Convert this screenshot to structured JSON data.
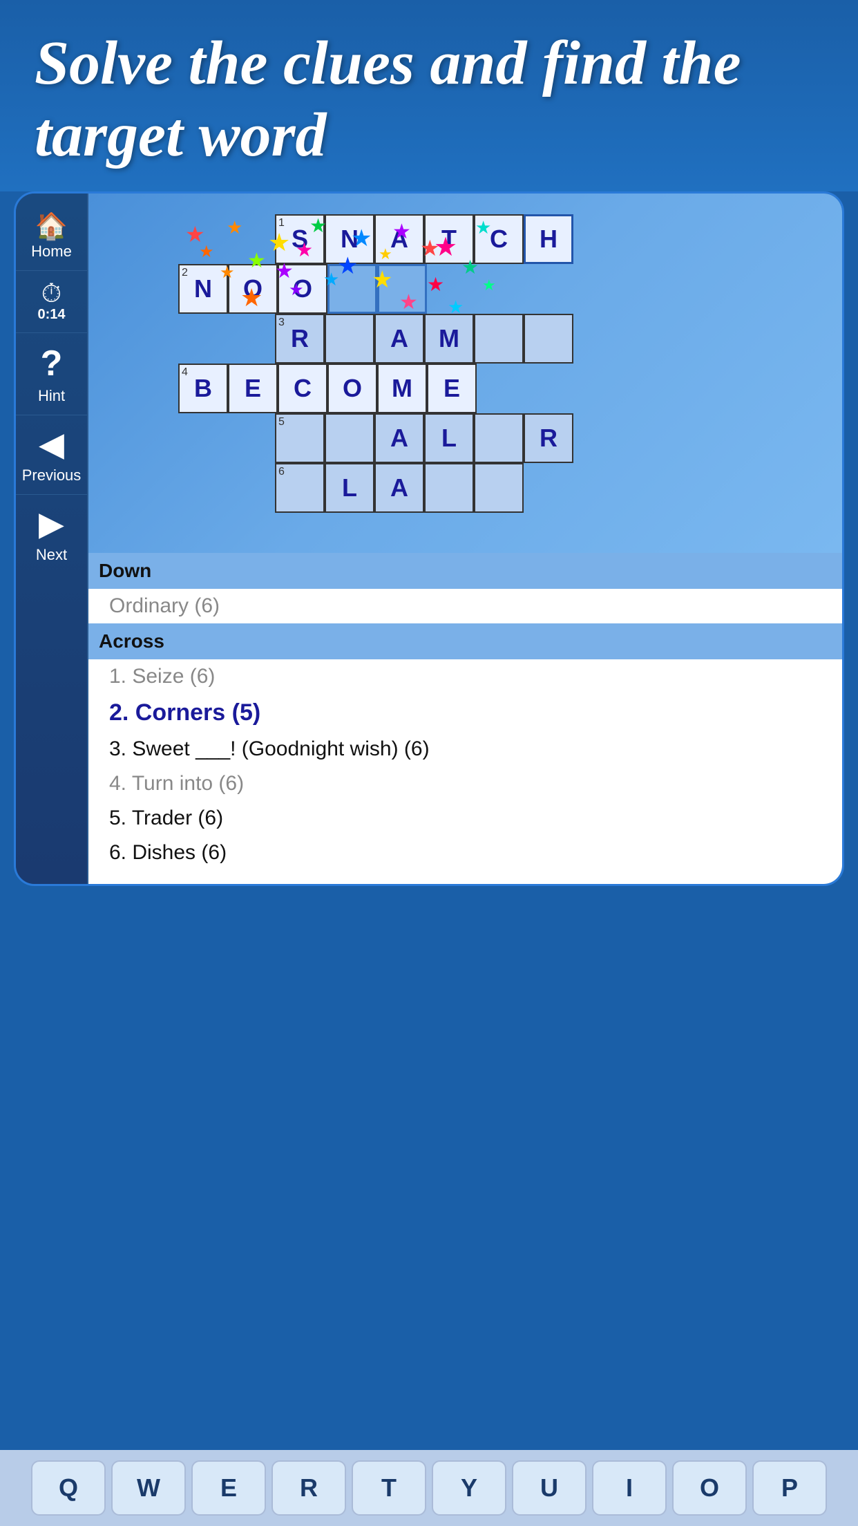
{
  "header": {
    "title": "Solve the clues and find the target word"
  },
  "sidebar": {
    "home_label": "Home",
    "timer_label": "0:14",
    "hint_label": "Hint",
    "previous_label": "Previous",
    "next_label": "Next"
  },
  "crossword": {
    "rows": [
      {
        "number": "1",
        "cells": [
          "S",
          "N",
          "A",
          "T",
          "C",
          "H"
        ],
        "style": "snatch"
      },
      {
        "number": "2",
        "cells": [
          "N",
          "O",
          "O",
          "",
          "",
          ""
        ],
        "style": "nooks"
      },
      {
        "number": "3",
        "cells": [
          "R",
          "",
          "A",
          "M",
          "",
          ""
        ],
        "style": "normal"
      },
      {
        "number": "4",
        "cells": [
          "B",
          "E",
          "C",
          "O",
          "M",
          "E"
        ],
        "style": "normal"
      },
      {
        "number": "5",
        "cells": [
          "",
          "",
          "A",
          "L",
          "",
          "R"
        ],
        "style": "normal"
      },
      {
        "number": "6",
        "cells": [
          "",
          "",
          "L",
          "A",
          "",
          "",
          ""
        ],
        "style": "normal"
      }
    ]
  },
  "clues": {
    "down_header": "Down",
    "down_items": [
      {
        "text": "Ordinary (6)",
        "active": false,
        "dark": false
      }
    ],
    "across_header": "Across",
    "across_items": [
      {
        "number": "1",
        "text": "Seize (6)",
        "active": false,
        "dark": false
      },
      {
        "number": "2",
        "text": "Corners (5)",
        "active": true,
        "dark": true
      },
      {
        "number": "3",
        "text": "Sweet ___! (Goodnight wish) (6)",
        "active": false,
        "dark": true
      },
      {
        "number": "4",
        "text": "Turn into (6)",
        "active": false,
        "dark": false
      },
      {
        "number": "5",
        "text": "Trader (6)",
        "active": false,
        "dark": true
      },
      {
        "number": "6",
        "text": "Dishes (6)",
        "active": false,
        "dark": true
      }
    ]
  },
  "keyboard": {
    "keys": [
      "Q",
      "W",
      "E",
      "R",
      "T",
      "Y",
      "U",
      "I",
      "O",
      "P"
    ]
  },
  "stars": [
    "🌟",
    "⭐",
    "🌟",
    "⭐",
    "🌟",
    "⭐",
    "🌟",
    "⭐",
    "🌟",
    "⭐",
    "🌟",
    "⭐",
    "🌟",
    "⭐",
    "🌟",
    "⭐",
    "🌟",
    "⭐",
    "🌟",
    "⭐"
  ]
}
